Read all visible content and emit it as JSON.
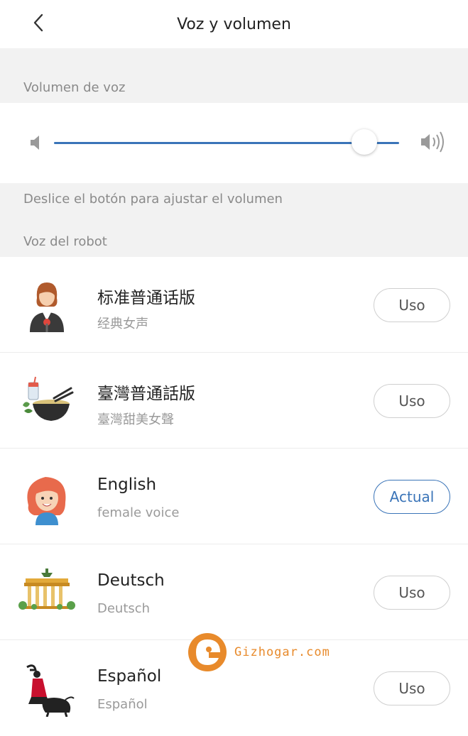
{
  "header": {
    "title": "Voz y volumen",
    "back_icon": "chevron-left-icon"
  },
  "volume": {
    "section_label": "Volumen de voz",
    "level": 0.9,
    "hint": "Deslice el botón para ajustar el volumen",
    "low_icon": "speaker-low-icon",
    "high_icon": "speaker-high-icon"
  },
  "voices": {
    "section_label": "Voz del robot",
    "items": [
      {
        "name": "标准普通话版",
        "subtitle": "经典女声",
        "button": "Uso",
        "active": false,
        "icon": "woman-presenter-icon"
      },
      {
        "name": "臺灣普通話版",
        "subtitle": "臺灣甜美女聲",
        "button": "Uso",
        "active": false,
        "icon": "noodle-bowl-icon"
      },
      {
        "name": "English",
        "subtitle": "female voice",
        "button": "Actual",
        "active": true,
        "icon": "red-hair-girl-icon"
      },
      {
        "name": "Deutsch",
        "subtitle": "Deutsch",
        "button": "Uso",
        "active": false,
        "icon": "brandenburg-gate-icon"
      },
      {
        "name": "Español",
        "subtitle": "Español",
        "button": "Uso",
        "active": false,
        "icon": "flamenco-bull-icon"
      }
    ]
  },
  "watermark": {
    "text": "Gizhogar.com"
  },
  "colors": {
    "accent": "#3a74b8",
    "section_bg": "#f2f2f2",
    "watermark": "#e88a2b"
  }
}
